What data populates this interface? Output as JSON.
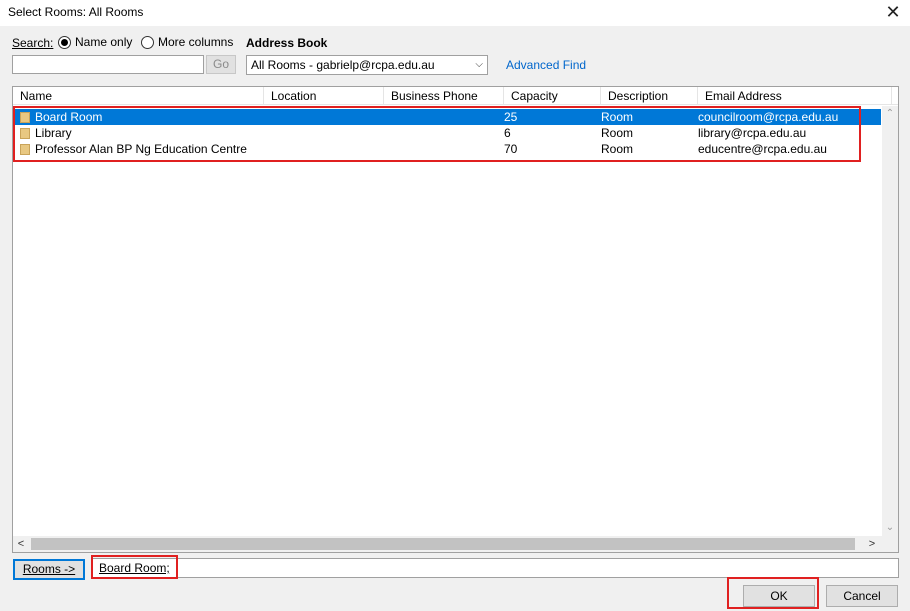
{
  "window": {
    "title": "Select Rooms: All Rooms",
    "close_glyph": "✕"
  },
  "search": {
    "label": "Search:",
    "option_name_only": "Name only",
    "option_more_columns": "More columns",
    "selected_option": "Name only",
    "input_value": "",
    "go_label": "Go"
  },
  "address_book": {
    "label": "Address Book",
    "selected": "All Rooms - gabrielp@rcpa.edu.au",
    "chevron_glyph": "⌵"
  },
  "advanced_find": "Advanced Find",
  "table": {
    "columns": [
      "Name",
      "Location",
      "Business Phone",
      "Capacity",
      "Description",
      "Email Address"
    ],
    "rows": [
      {
        "name": "Board Room",
        "location": "",
        "phone": "",
        "capacity": "25",
        "description": "Room",
        "email": "councilroom@rcpa.edu.au",
        "selected": true
      },
      {
        "name": "Library",
        "location": "",
        "phone": "",
        "capacity": "6",
        "description": "Room",
        "email": "library@rcpa.edu.au",
        "selected": false
      },
      {
        "name": "Professor Alan BP Ng Education Centre",
        "location": "",
        "phone": "",
        "capacity": "70",
        "description": "Room",
        "email": "educentre@rcpa.edu.au",
        "selected": false
      }
    ]
  },
  "rooms_button": "Rooms ->",
  "rooms_value": "Board Room;",
  "ok_label": "OK",
  "cancel_label": "Cancel",
  "colors": {
    "selection": "#0078d7",
    "highlight_box": "#e02020",
    "link": "#0066cc"
  }
}
